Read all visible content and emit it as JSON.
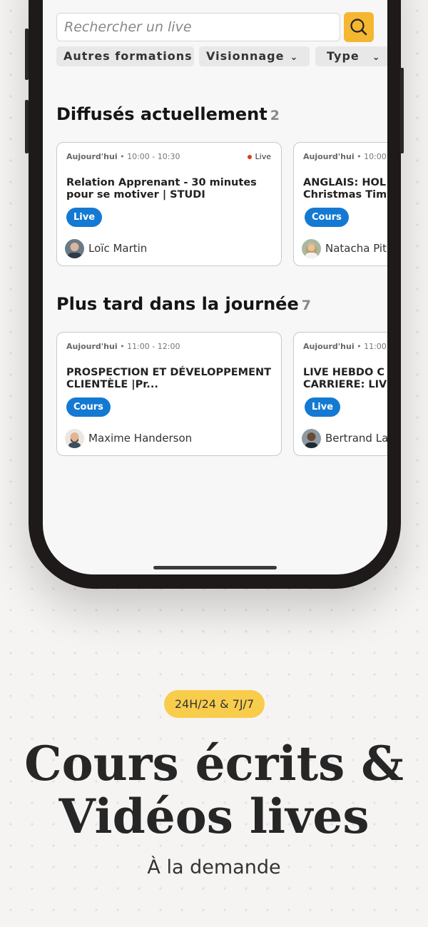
{
  "search": {
    "placeholder": "Rechercher un live"
  },
  "filters": [
    {
      "label": "Autres formations"
    },
    {
      "label": "Visionnage"
    },
    {
      "label": "Type"
    }
  ],
  "sections": [
    {
      "title": "Diffusés actuellement",
      "count": "2",
      "cards": [
        {
          "day": "Aujourd'hui",
          "time": "• 10:00 - 10:30",
          "live_label": "Live",
          "title": "Relation Apprenant - 30 minutes pour se motiver | STUDI",
          "badge": "Live",
          "person": "Loïc Martin"
        },
        {
          "day": "Aujourd'hui",
          "time": "• 10:00 -",
          "title": "ANGLAIS: HOL Christmas Tim",
          "badge": "Cours",
          "person": "Natacha Pit"
        }
      ]
    },
    {
      "title": "Plus tard dans la journée",
      "count": "7",
      "cards": [
        {
          "day": "Aujourd'hui",
          "time": "• 11:00 - 12:00",
          "title": "PROSPECTION ET DÉVELOPPEMENT CLIENTÈLE |Pr...",
          "badge": "Cours",
          "person": "Maxime Handerson"
        },
        {
          "day": "Aujourd'hui",
          "time": "• 11:00 -",
          "title": "LIVE HEBDO C CARRIERE: LIV",
          "badge": "Live",
          "person": "Bertrand La"
        }
      ]
    }
  ],
  "promo": {
    "pill": "24H/24 & 7J/7",
    "headline_line1": "Cours écrits &",
    "headline_line2": "Vidéos lives",
    "subline": "À la demande"
  },
  "colors": {
    "accent": "#f5b731",
    "badge_blue": "#1479d2",
    "live_dot": "#e03a1d",
    "pill": "#f8cd4c"
  }
}
